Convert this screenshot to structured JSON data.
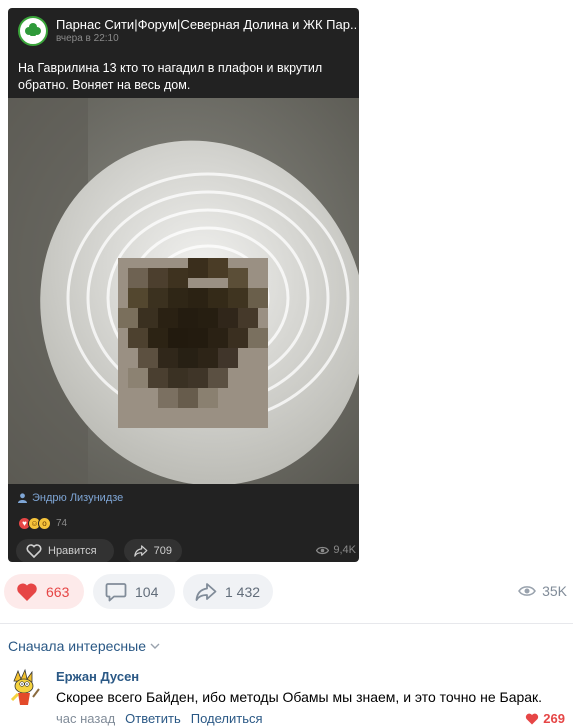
{
  "post": {
    "group_name": "Парнас Сити|Форум|Северная Долина и ЖК Пар...",
    "time": "вчера в 22:10",
    "text": "На Гаврилина 13 кто то нагадил в плафон и вкрутил обратно. Воняет на весь дом.",
    "author": "Эндрю Лизунидзе",
    "reactions_count": "74",
    "like_label": "Нравится",
    "share_count": "709",
    "views": "9,4K",
    "logo_icon": "clover-logo-icon"
  },
  "actions": {
    "likes": "663",
    "comments": "104",
    "reposts": "1 432",
    "views": "35K",
    "accent": "#e64646"
  },
  "comments": {
    "sort_label": "Сначала интересные",
    "items": [
      {
        "author": "Ержан Дусен",
        "text": "Скорее всего Байден, ибо методы Обамы мы знаем, и это точно не Барак.",
        "time": "час назад",
        "reply_label": "Ответить",
        "share_label": "Поделиться",
        "likes": "269"
      }
    ]
  }
}
